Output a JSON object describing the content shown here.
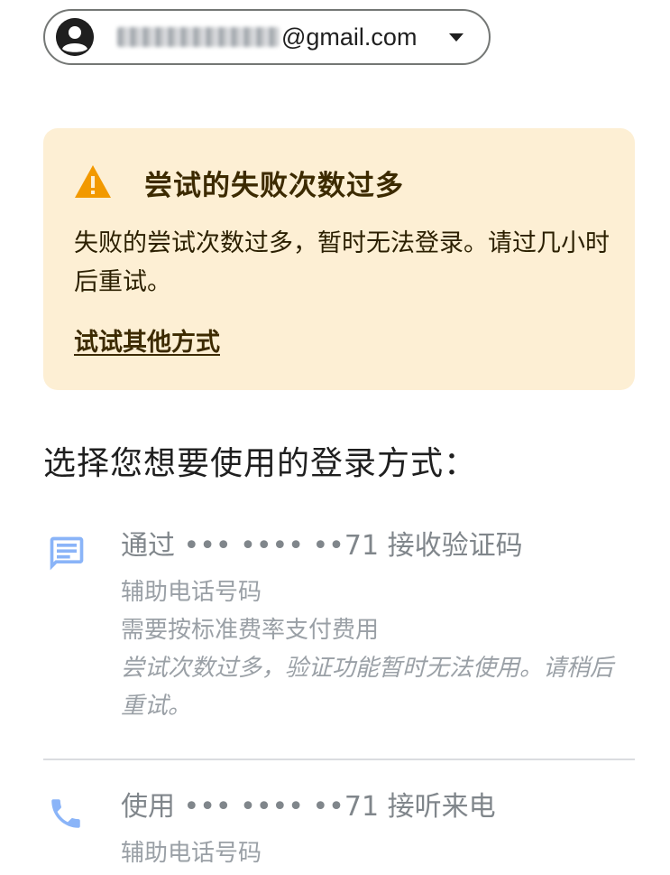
{
  "account": {
    "email_suffix": "@gmail.com",
    "icon": "account-circle-icon",
    "dropdown_icon": "chevron-down-icon"
  },
  "warning": {
    "icon": "warning-triangle-icon",
    "title": "尝试的失败次数过多",
    "body": "失败的尝试次数过多，暂时无法登录。请过几小时后重试。",
    "link": "试试其他方式",
    "background": "#fdefd4",
    "icon_color": "#f29900"
  },
  "heading": "选择您想要使用的登录方式：",
  "options": [
    {
      "icon": "sms-icon",
      "title": "通过 ••• •••• ••71 接收验证码",
      "lines": [
        "辅助电话号码",
        "需要按标准费率支付费用"
      ],
      "note": "尝试次数过多，验证功能暂时无法使用。请稍后重试。"
    },
    {
      "icon": "phone-icon",
      "title": "使用 ••• •••• ••71 接听来电",
      "lines": [
        "辅助电话号码"
      ]
    }
  ],
  "colors": {
    "accent_icon": "#8ab4f8",
    "text_primary": "#1f1f1f",
    "text_disabled": "#80868b"
  }
}
